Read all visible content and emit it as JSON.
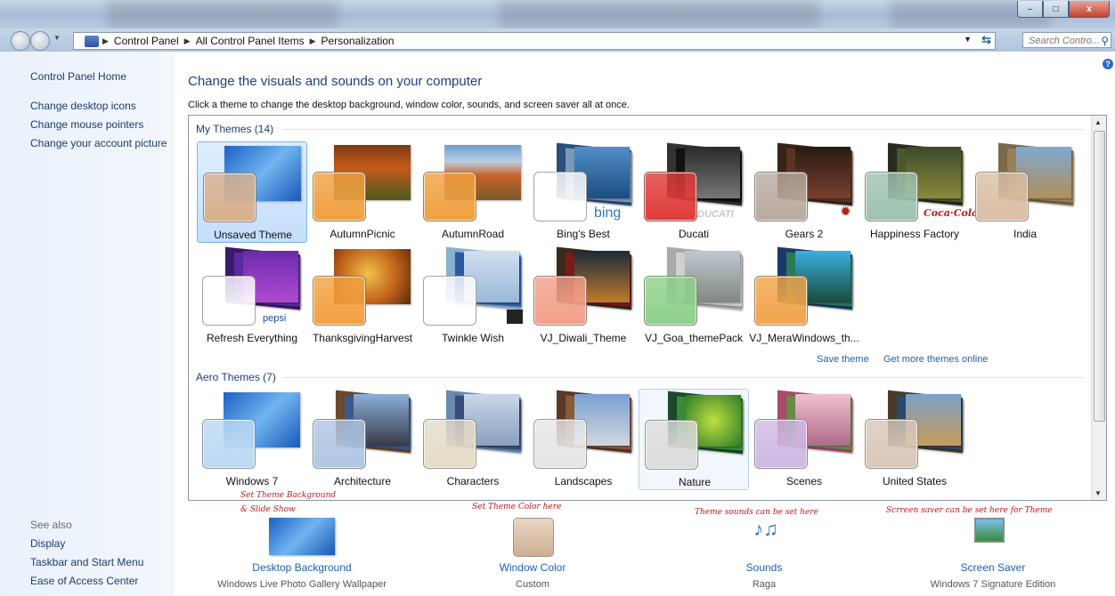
{
  "window": {
    "minimize_glyph": "–",
    "maximize_glyph": "□",
    "close_glyph": "x"
  },
  "address_bar": {
    "crumbs": [
      "Control Panel",
      "All Control Panel Items",
      "Personalization"
    ],
    "search_placeholder": "Search Contro..."
  },
  "sidebar": {
    "home": "Control Panel Home",
    "tasks": [
      "Change desktop icons",
      "Change mouse pointers",
      "Change your account picture"
    ],
    "see_also_label": "See also",
    "see_also": [
      "Display",
      "Taskbar and Start Menu",
      "Ease of Access Center"
    ]
  },
  "main": {
    "help_glyph": "?",
    "title": "Change the visuals and sounds on your computer",
    "description": "Click a theme to change the desktop background, window color, sounds, and screen saver all at once.",
    "my_themes_header": "My Themes (14)",
    "aero_themes_header": "Aero Themes (7)",
    "save_theme": "Save theme",
    "get_more": "Get more themes online",
    "my_themes": [
      {
        "label": "Unsaved Theme",
        "color": "#d9b08c",
        "selected": true
      },
      {
        "label": "AutumnPicnic",
        "color": "#f0a040"
      },
      {
        "label": "AutumnRoad",
        "color": "#f0a040"
      },
      {
        "label": "Bing's Best",
        "color": "#ffffff",
        "brand": "bing"
      },
      {
        "label": "Ducati",
        "color": "#e03a3a",
        "brand": "DUCATI"
      },
      {
        "label": "Gears 2",
        "color": "#b8aaa0"
      },
      {
        "label": "Happiness Factory",
        "color": "#9fc2b0",
        "brand": "Coca-Cola"
      },
      {
        "label": "India",
        "color": "#d9bfa4"
      },
      {
        "label": "Refresh Everything",
        "color": "#ffffff",
        "brand": "pepsi"
      },
      {
        "label": "ThanksgivingHarvest",
        "color": "#f3a040"
      },
      {
        "label": "Twinkle Wish",
        "color": "#ffffff"
      },
      {
        "label": "VJ_Diwali_Theme",
        "color": "#f2a08a"
      },
      {
        "label": "VJ_Goa_themePack",
        "color": "#8fd08a"
      },
      {
        "label": "VJ_MeraWindows_th...",
        "color": "#f1a44a"
      }
    ],
    "aero_themes": [
      {
        "label": "Windows 7",
        "color": "#bcd9f2"
      },
      {
        "label": "Architecture",
        "color": "#b0c6e2"
      },
      {
        "label": "Characters",
        "color": "#e4dcc8"
      },
      {
        "label": "Landscapes",
        "color": "#e6e6e6"
      },
      {
        "label": "Nature",
        "color": "#dcdcdc",
        "hover": true
      },
      {
        "label": "Scenes",
        "color": "#cfb9e3"
      },
      {
        "label": "United States",
        "color": "#d8c8b8"
      }
    ]
  },
  "annotations": {
    "background": [
      "Set Theme Background",
      "& Slide Show"
    ],
    "color": "Set Theme Color here",
    "sounds": "Theme sounds can be set here",
    "saver": "Scrreen saver can be set here for Theme"
  },
  "settings": [
    {
      "title": "Desktop Background",
      "subtitle": "Windows Live Photo Gallery Wallpaper"
    },
    {
      "title": "Window Color",
      "subtitle": "Custom"
    },
    {
      "title": "Sounds",
      "subtitle": "Raga"
    },
    {
      "title": "Screen Saver",
      "subtitle": "Windows 7 Signature Edition"
    }
  ]
}
